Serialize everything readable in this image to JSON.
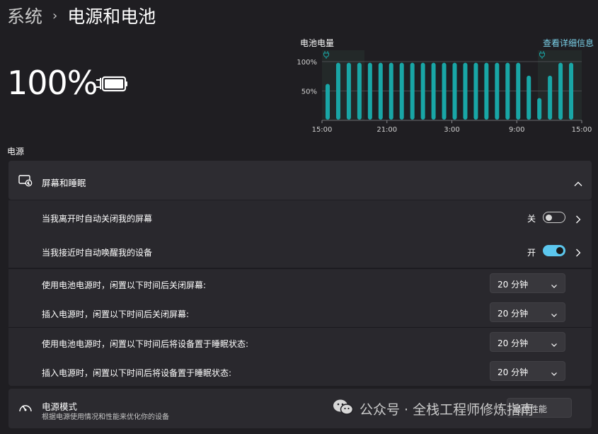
{
  "breadcrumb": {
    "parent": "系统",
    "separator": "›",
    "current": "电源和电池"
  },
  "battery": {
    "percent": "100%",
    "status_icon": "battery-charging-icon",
    "level": 1.0
  },
  "chart": {
    "title": "电池电量",
    "details_link": "查看详细信息"
  },
  "chart_data": {
    "type": "bar",
    "x_tick_labels": [
      "15:00",
      "21:00",
      "3:00",
      "9:00",
      "15:00"
    ],
    "y_tick_labels": [
      "100%",
      "50%"
    ],
    "ylim": [
      0,
      100
    ],
    "values": [
      62,
      98,
      98,
      98,
      98,
      98,
      98,
      98,
      98,
      98,
      98,
      98,
      98,
      98,
      98,
      98,
      98,
      98,
      98,
      76,
      38,
      76,
      98,
      98
    ],
    "color": "#19a6a6",
    "grid": true,
    "charging_markers": [
      "15:00",
      "11:00"
    ]
  },
  "power_section": {
    "label": "电源"
  },
  "screen_sleep": {
    "title": "屏幕和睡眠",
    "auto_off_when_away": {
      "label": "当我离开时自动关闭我的屏幕",
      "state": "关",
      "on": false
    },
    "wake_on_approach": {
      "label": "当我接近时自动唤醒我的设备",
      "state": "开",
      "on": true
    },
    "battery_screen_off": {
      "label": "使用电池电源时，闲置以下时间后关闭屏幕:",
      "value": "20 分钟"
    },
    "plugged_screen_off": {
      "label": "插入电源时，闲置以下时间后关闭屏幕:",
      "value": "20 分钟"
    },
    "battery_sleep": {
      "label": "使用电池电源时，闲置以下时间后将设备置于睡眠状态:",
      "value": "20 分钟"
    },
    "plugged_sleep": {
      "label": "插入电源时，闲置以下时间后将设备置于睡眠状态:",
      "value": "20 分钟"
    }
  },
  "power_mode": {
    "title": "电源模式",
    "subtitle": "根据电源使用情况和性能来优化你的设备",
    "value": "最佳性能"
  },
  "watermark": {
    "text": "公众号 · 全栈工程师修炼指南"
  },
  "colors": {
    "accent": "#5cc7ee",
    "chart_bar": "#19a6a6",
    "link": "#7ad0e8",
    "background": "#1f1e22"
  }
}
